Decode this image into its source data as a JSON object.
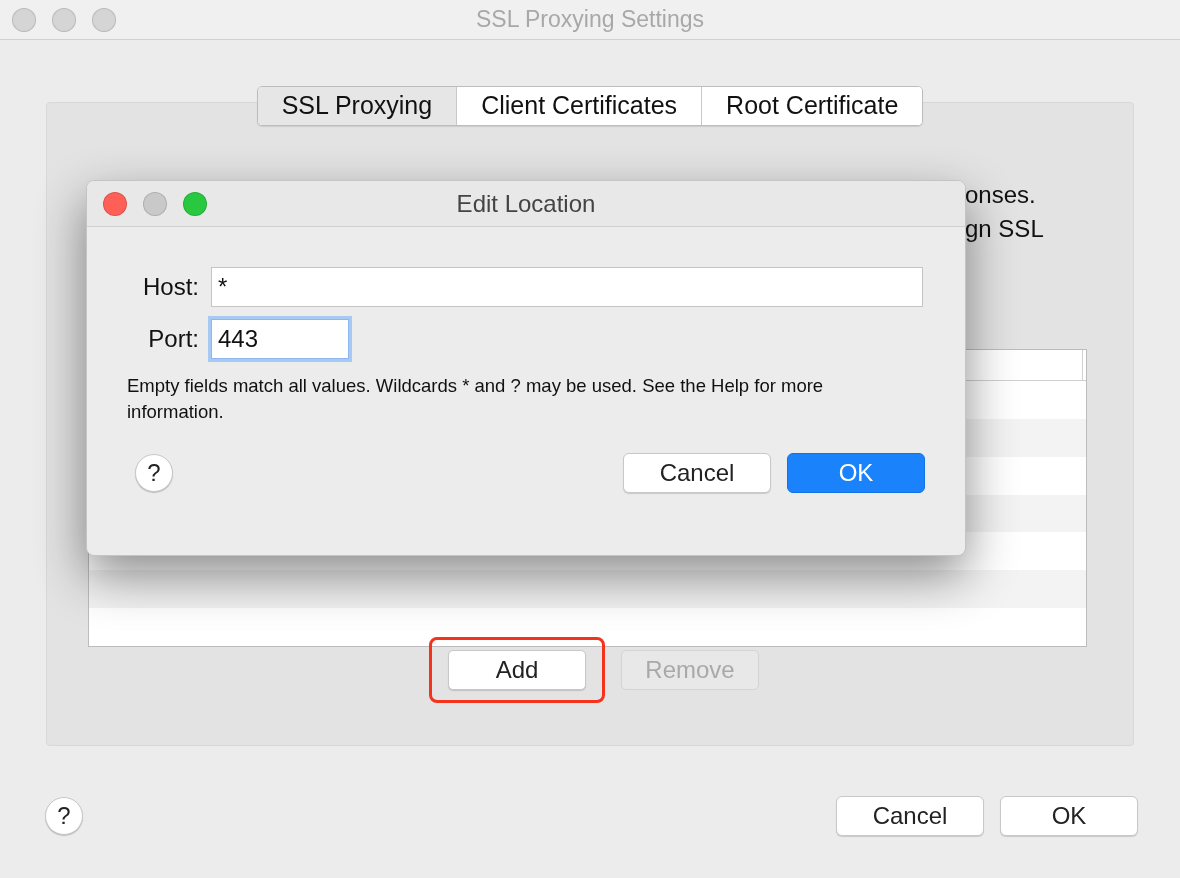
{
  "window": {
    "title": "SSL Proxying Settings",
    "active": false
  },
  "tabs": [
    {
      "label": "SSL Proxying",
      "selected": true
    },
    {
      "label": "Client Certificates",
      "selected": false
    },
    {
      "label": "Root Certificate",
      "selected": false
    }
  ],
  "description_fragments": [
    "onses.",
    "gn SSL"
  ],
  "list_buttons": [
    {
      "label": "Add",
      "disabled": false,
      "highlighted": true
    },
    {
      "label": "Remove",
      "disabled": true,
      "highlighted": false
    }
  ],
  "help_button": "?",
  "footer_buttons": [
    {
      "label": "Cancel",
      "default": false
    },
    {
      "label": "OK",
      "default": false
    }
  ],
  "dialog": {
    "title": "Edit Location",
    "active": true,
    "fields": [
      {
        "label": "Host:",
        "value": "*",
        "focused": false
      },
      {
        "label": "Port:",
        "value": "443",
        "focused": true
      }
    ],
    "note": "Empty fields match all values. Wildcards * and ? may be used. See the Help for more information.",
    "help_button": "?",
    "buttons": [
      {
        "label": "Cancel",
        "default": false
      },
      {
        "label": "OK",
        "default": true
      }
    ]
  }
}
